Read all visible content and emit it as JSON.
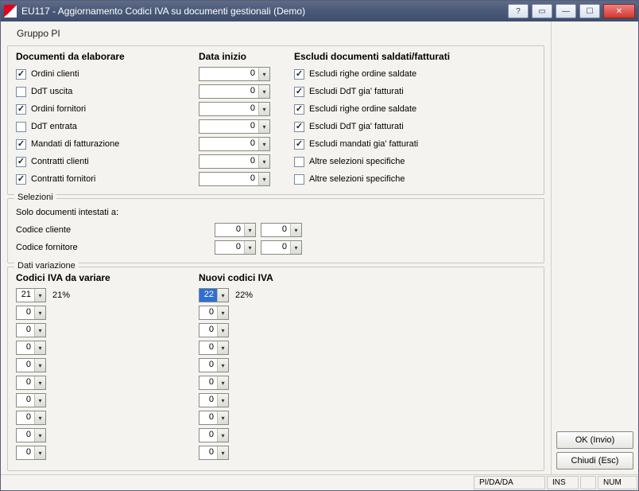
{
  "window": {
    "title": "EU117 - Aggiornamento Codici IVA su documenti gestionali  (Demo)"
  },
  "toolbar": {
    "text": "Gruppo  PI"
  },
  "headings": {
    "docs": "Documenti da elaborare",
    "data_inizio": "Data inizio",
    "escludi": "Escludi documenti saldati/fatturati",
    "selezioni": "Selezioni",
    "solo_doc": "Solo documenti intestati a:",
    "cod_cliente": "Codice cliente",
    "cod_fornitore": "Codice fornitore",
    "dati_variazione": "Dati variazione",
    "codici_variare": "Codici IVA da variare",
    "nuovi_codici": "Nuovi codici IVA"
  },
  "docs": [
    {
      "label": "Ordini clienti",
      "checked": true
    },
    {
      "label": "DdT uscita",
      "checked": false
    },
    {
      "label": "Ordini fornitori",
      "checked": true
    },
    {
      "label": "DdT entrata",
      "checked": false
    },
    {
      "label": "Mandati di fatturazione",
      "checked": true
    },
    {
      "label": "Contratti clienti",
      "checked": true
    },
    {
      "label": "Contratti fornitori",
      "checked": true
    }
  ],
  "data_inizio": [
    "0",
    "0",
    "0",
    "0",
    "0",
    "0",
    "0"
  ],
  "escludi": [
    {
      "label": "Escludi righe ordine saldate",
      "checked": true
    },
    {
      "label": "Escludi DdT gia' fatturati",
      "checked": true
    },
    {
      "label": "Escludi righe ordine saldate",
      "checked": true
    },
    {
      "label": "Escludi DdT gia' fatturati",
      "checked": true
    },
    {
      "label": "Escludi mandati gia' fatturati",
      "checked": true
    },
    {
      "label": "Altre selezioni specifiche",
      "checked": false
    },
    {
      "label": "Altre selezioni specifiche",
      "checked": false
    }
  ],
  "selezioni": {
    "cliente": [
      "0",
      "0"
    ],
    "fornitore": [
      "0",
      "0"
    ]
  },
  "codici_variare": [
    {
      "code": "21",
      "desc": "21%"
    },
    {
      "code": "0",
      "desc": ""
    },
    {
      "code": "0",
      "desc": ""
    },
    {
      "code": "0",
      "desc": ""
    },
    {
      "code": "0",
      "desc": ""
    },
    {
      "code": "0",
      "desc": ""
    },
    {
      "code": "0",
      "desc": ""
    },
    {
      "code": "0",
      "desc": ""
    },
    {
      "code": "0",
      "desc": ""
    },
    {
      "code": "0",
      "desc": ""
    }
  ],
  "nuovi_codici": [
    {
      "code": "22",
      "desc": "22%",
      "highlight": true
    },
    {
      "code": "0",
      "desc": ""
    },
    {
      "code": "0",
      "desc": ""
    },
    {
      "code": "0",
      "desc": ""
    },
    {
      "code": "0",
      "desc": ""
    },
    {
      "code": "0",
      "desc": ""
    },
    {
      "code": "0",
      "desc": ""
    },
    {
      "code": "0",
      "desc": ""
    },
    {
      "code": "0",
      "desc": ""
    },
    {
      "code": "0",
      "desc": ""
    }
  ],
  "buttons": {
    "ok": "OK (Invio)",
    "close": "Chiudi (Esc)"
  },
  "statusbar": {
    "mode": "PI/DA/DA",
    "ins": "INS",
    "num": "NUM"
  }
}
